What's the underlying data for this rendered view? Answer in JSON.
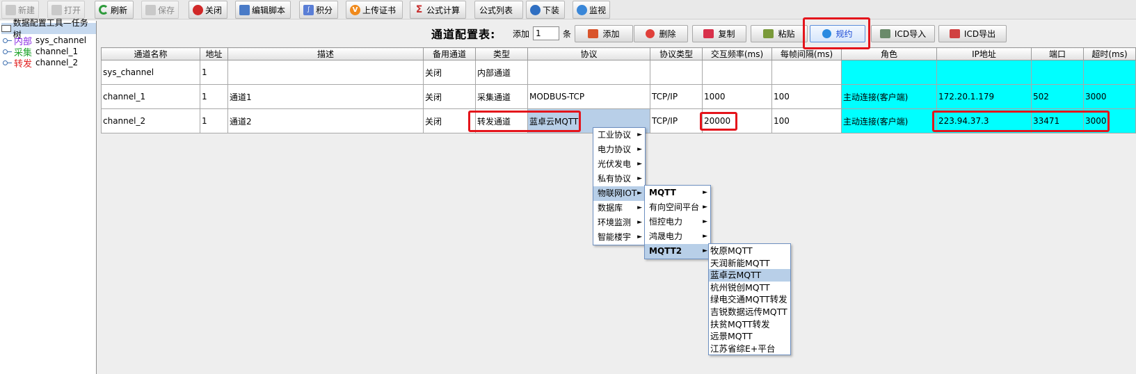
{
  "toolbar": [
    {
      "label": "新建",
      "icon": "new-file-icon",
      "enabled": false
    },
    {
      "label": "打开",
      "icon": "open-folder-icon",
      "enabled": false
    },
    {
      "label": "刷新",
      "icon": "refresh-icon",
      "enabled": true
    },
    {
      "label": "保存",
      "icon": "save-icon",
      "enabled": false
    },
    {
      "label": "关闭",
      "icon": "power-icon",
      "enabled": true
    },
    {
      "label": "编辑脚本",
      "icon": "script-icon",
      "enabled": true
    },
    {
      "label": "积分",
      "icon": "integral-icon",
      "enabled": true
    },
    {
      "label": "上传证书",
      "icon": "certificate-icon",
      "enabled": true
    },
    {
      "label": "公式计算",
      "icon": "sigma-icon",
      "enabled": true
    },
    {
      "label": "公式列表",
      "icon": "",
      "enabled": true
    },
    {
      "label": "下装",
      "icon": "download-list-icon",
      "enabled": true
    },
    {
      "label": "监视",
      "icon": "monitor-icon",
      "enabled": true
    }
  ],
  "tree": {
    "root": "数据配置工具—任务树",
    "items": [
      {
        "tag": "内部",
        "tag_color": "#8a2be2",
        "name": "sys_channel"
      },
      {
        "tag": "采集",
        "tag_color": "#22a52e",
        "name": "channel_1"
      },
      {
        "tag": "转发",
        "tag_color": "#e02020",
        "name": "channel_2"
      }
    ]
  },
  "header": {
    "title": "通道配置表:",
    "add_label": "添加",
    "add_count": "1",
    "unit_label": "条",
    "buttons": [
      {
        "label": "添加",
        "icon": "add-channel-icon",
        "color": "#d9542b"
      },
      {
        "label": "删除",
        "icon": "delete-icon",
        "color": "#e0403a"
      },
      {
        "label": "复制",
        "icon": "copy-icon",
        "color": "#d8304a"
      },
      {
        "label": "粘贴",
        "icon": "paste-icon",
        "color": "#7a9a3a"
      },
      {
        "label": "规约",
        "icon": "protocol-gear-icon",
        "color": "#2a8ae0"
      },
      {
        "label": "ICD导入",
        "icon": "icd-import-icon",
        "color": "#6a8a6a"
      },
      {
        "label": "ICD导出",
        "icon": "icd-export-icon",
        "color": "#d04040"
      }
    ]
  },
  "table": {
    "columns": [
      "通道名称",
      "地址",
      "描述",
      "备用通道",
      "类型",
      "协议",
      "协议类型",
      "交互频率(ms)",
      "每帧间隔(ms)",
      "角色",
      "IP地址",
      "端口",
      "超时(ms)"
    ],
    "rows": [
      [
        "sys_channel",
        "1",
        "",
        "关闭",
        "内部通道",
        "",
        "",
        "",
        "",
        "",
        "",
        "",
        ""
      ],
      [
        "channel_1",
        "1",
        "通道1",
        "关闭",
        "采集通道",
        "MODBUS-TCP",
        "TCP/IP",
        "1000",
        "100",
        "主动连接(客户端)",
        "172.20.1.179",
        "502",
        "3000"
      ],
      [
        "channel_2",
        "1",
        "通道2",
        "关闭",
        "转发通道",
        "蓝卓云MQTT",
        "TCP/IP",
        "20000",
        "100",
        "主动连接(客户端)",
        "223.94.37.3",
        "33471",
        "3000"
      ]
    ]
  },
  "menu_l1": [
    {
      "label": "工业协议",
      "sub": true
    },
    {
      "label": "电力协议",
      "sub": true
    },
    {
      "label": "光伏发电",
      "sub": true
    },
    {
      "label": "私有协议",
      "sub": true
    },
    {
      "label": "物联网IOT",
      "sub": true,
      "highlight": true
    },
    {
      "label": "数据库",
      "sub": true
    },
    {
      "label": "环境监测",
      "sub": true
    },
    {
      "label": "智能楼宇",
      "sub": true
    }
  ],
  "menu_l2": [
    {
      "label": "MQTT",
      "sub": true
    },
    {
      "label": "有向空间平台",
      "sub": true
    },
    {
      "label": "恒控电力",
      "sub": true
    },
    {
      "label": "鸿晟电力",
      "sub": true
    },
    {
      "label": "MQTT2",
      "sub": true,
      "highlight": true
    }
  ],
  "menu_l3": [
    {
      "label": "牧原MQTT"
    },
    {
      "label": "天润新能MQTT"
    },
    {
      "label": "蓝卓云MQTT",
      "highlight": true
    },
    {
      "label": "杭州锐创MQTT"
    },
    {
      "label": "绿电交通MQTT转发"
    },
    {
      "label": "吉锐数据远传MQTT"
    },
    {
      "label": "扶贫MQTT转发"
    },
    {
      "label": "远景MQTT"
    },
    {
      "label": "江苏省综E+平台"
    }
  ],
  "colors": {
    "highlight_cyan": "#00ffff",
    "selection": "#b8cfe8",
    "annotation_red": "#e4141b"
  }
}
